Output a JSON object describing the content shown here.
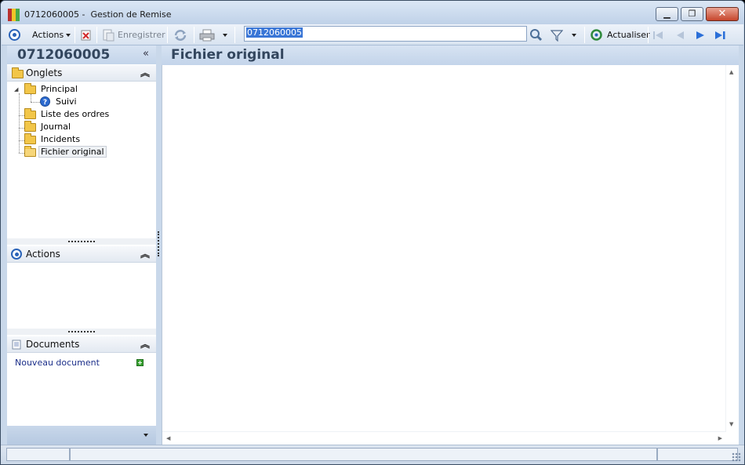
{
  "window": {
    "title": "0712060005 -  Gestion de Remise"
  },
  "toolbar": {
    "actions_label": "Actions",
    "save_label": "Enregistrer",
    "search_value": "0712060005",
    "refresh_label": "Actualiser"
  },
  "left_panel": {
    "record_id": "0712060005",
    "collapse_glyph": "«",
    "onglets": {
      "title": "Onglets",
      "items": [
        {
          "label": "Principal"
        },
        {
          "label": "Suivi"
        },
        {
          "label": "Liste des ordres"
        },
        {
          "label": "Journal"
        },
        {
          "label": "Incidents"
        },
        {
          "label": "Fichier original"
        }
      ]
    },
    "actions": {
      "title": "Actions"
    },
    "documents": {
      "title": "Documents",
      "new_document": "Nouveau document"
    }
  },
  "main": {
    "title": "Fichier original"
  },
  "colors": {
    "accent": "#2a63b8",
    "header_text": "#33465e",
    "link": "#1c2f8a",
    "selection": "#3a76d6"
  },
  "icons": {
    "app": "app-logo-icon",
    "actions": "target-icon",
    "delete": "delete-icon",
    "save": "save-document-icon",
    "sync": "sync-icon",
    "print": "printer-icon",
    "search": "magnifier-icon",
    "filter": "funnel-icon",
    "refresh": "refresh-icon",
    "first": "first-record-icon",
    "prev": "previous-record-icon",
    "next": "next-record-icon",
    "last": "last-record-icon"
  }
}
